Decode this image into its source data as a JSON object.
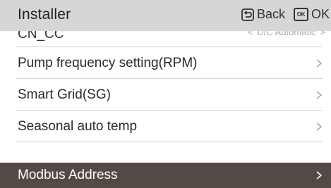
{
  "header": {
    "title": "Installer",
    "back_label": "Back",
    "ok_icon_text": "OK",
    "ok_label": "OK"
  },
  "menu": {
    "partial_item": {
      "label": "CN_CC",
      "value": "D/C Automatic",
      "prev_symbol": "<",
      "next_symbol": ">"
    },
    "items": [
      {
        "label": "Pump frequency setting(RPM)"
      },
      {
        "label": "Smart Grid(SG)"
      },
      {
        "label": "Seasonal auto temp"
      },
      {
        "label": "Modbus Address",
        "selected": true
      }
    ]
  },
  "colors": {
    "header_bg": "#d6d6d6",
    "selected_bg": "#544a45",
    "text": "#2a2a2a",
    "separator": "#d4d4d4"
  }
}
